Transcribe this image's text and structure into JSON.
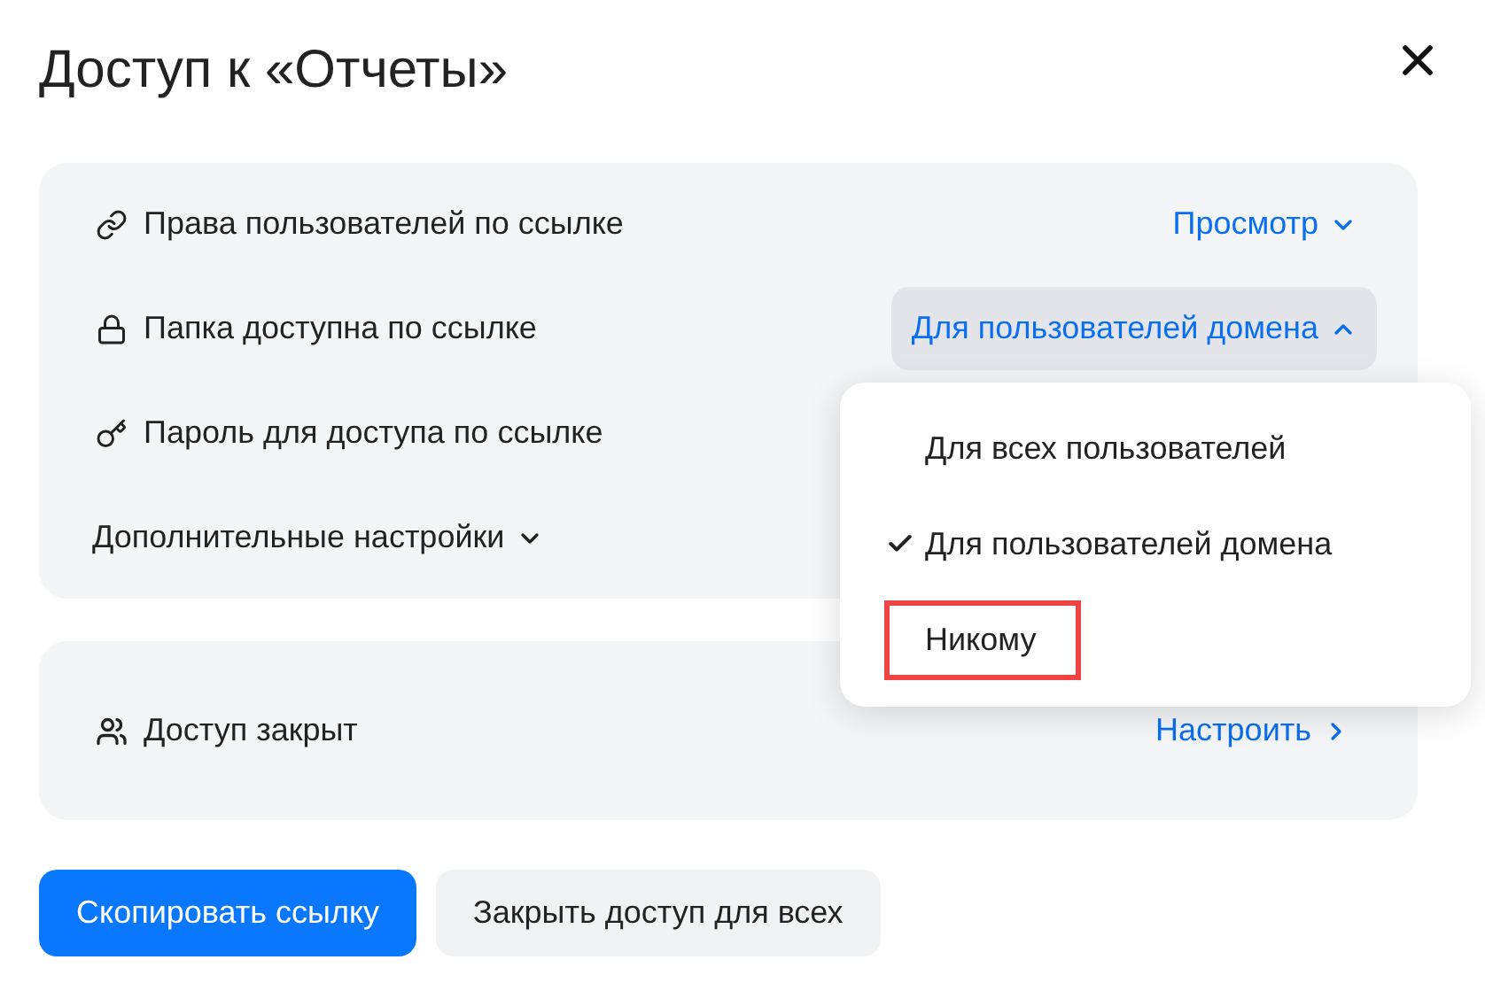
{
  "title": "Доступ к «Отчеты»",
  "settings": [
    {
      "kind": "link",
      "label": "Права пользователей по ссылке",
      "value": "Просмотр",
      "expanded": false
    },
    {
      "kind": "lock",
      "label": "Папка доступна по ссылке",
      "value": "Для пользователей домена",
      "expanded": true
    },
    {
      "kind": "key",
      "label": "Пароль для доступа по ссылке"
    }
  ],
  "advanced": {
    "label": "Дополнительные настройки",
    "expanded": false
  },
  "menu_options": [
    {
      "label": "Для всех пользователей",
      "selected": false,
      "highlighted": false
    },
    {
      "label": "Для пользователей домена",
      "selected": true,
      "highlighted": false
    },
    {
      "label": "Никому",
      "selected": false,
      "highlighted": true
    }
  ],
  "access": {
    "label": "Доступ закрыт",
    "action": "Настроить"
  },
  "buttons": [
    {
      "label": "Скопировать ссылку",
      "kind": "primary"
    },
    {
      "label": "Закрыть доступ для всех",
      "kind": "secondary"
    }
  ]
}
